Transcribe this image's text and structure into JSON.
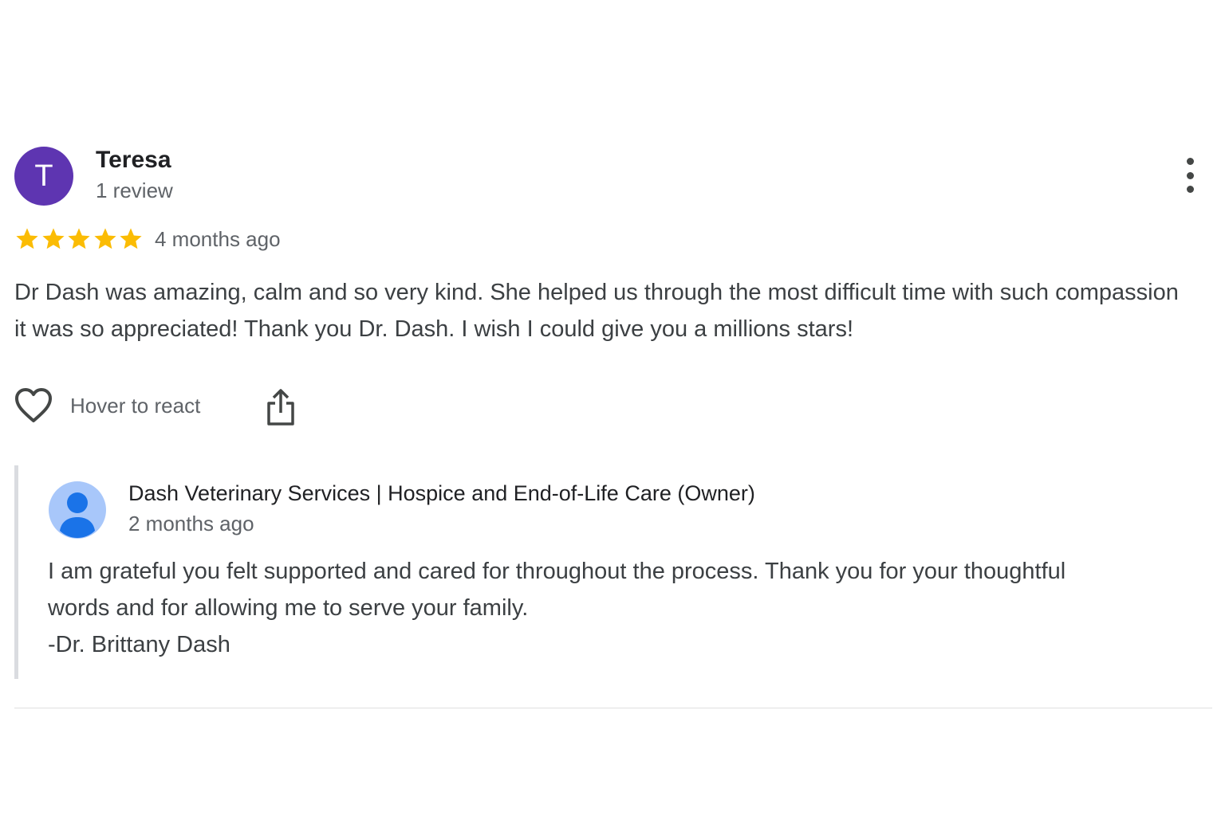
{
  "review": {
    "reviewer": {
      "initial": "T",
      "name": "Teresa",
      "review_count": "1 review",
      "avatar_color": "#5e35b1"
    },
    "rating": {
      "stars": 5,
      "max_stars": 5,
      "star_color": "#fbbc04"
    },
    "date": "4 months ago",
    "text": "Dr Dash was amazing, calm and so very kind. She helped us through the most difficult time with such compassion it was so appreciated! Thank you Dr. Dash. I wish I could give you a millions stars!",
    "actions": {
      "react_icon": "heart-icon",
      "react_label": "Hover to react",
      "share_icon": "share-icon",
      "more_icon": "more-vert-icon"
    }
  },
  "owner_reply": {
    "avatar_icon": "person-icon",
    "name": "Dash Veterinary Services | Hospice and End-of-Life Care (Owner)",
    "date": "2 months ago",
    "lines": [
      "I am grateful you felt supported and cared for throughout the process. Thank you for your thoughtful",
      "words and for allowing me to serve your family.",
      "-Dr. Brittany Dash"
    ]
  }
}
